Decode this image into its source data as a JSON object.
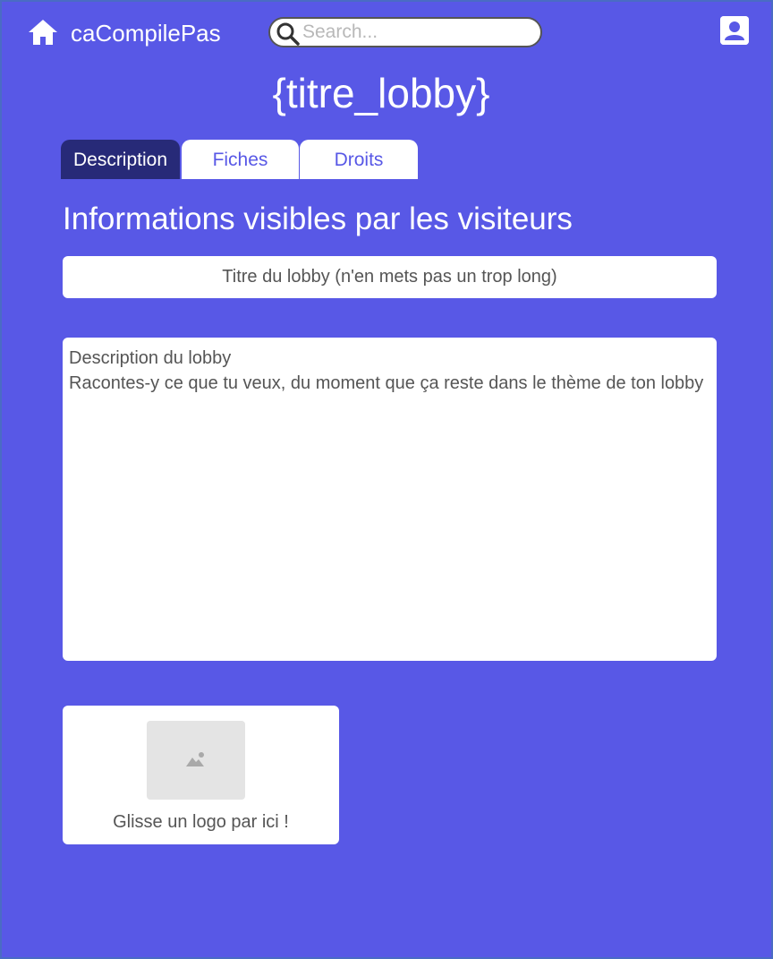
{
  "app": {
    "brand": "caCompilePas",
    "home_icon": "home-icon",
    "account_icon": "user-account-icon"
  },
  "search": {
    "placeholder": "Search..."
  },
  "page": {
    "title": "{titre_lobby}",
    "section_heading": "Informations visibles par les visiteurs"
  },
  "tabs": [
    {
      "label": "Description",
      "active": true
    },
    {
      "label": "Fiches",
      "active": false
    },
    {
      "label": "Droits",
      "active": false
    }
  ],
  "form": {
    "title_placeholder": "Titre du lobby (n'en mets pas un trop long)",
    "description_placeholder": "Description du lobby\nRacontes-y ce que tu veux, du moment que ça reste dans le thème de ton lobby",
    "logo_dropzone_label": "Glisse un logo par ici !",
    "logo_icon": "image-placeholder-icon"
  },
  "colors": {
    "background": "#5858e6",
    "active_tab": "#272a78",
    "surface": "#ffffff",
    "muted_text": "#555555"
  }
}
